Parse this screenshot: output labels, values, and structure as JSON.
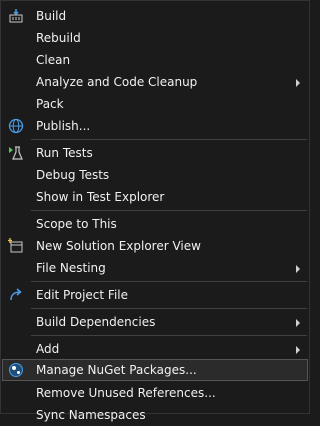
{
  "menu": {
    "build": "Build",
    "rebuild": "Rebuild",
    "clean": "Clean",
    "analyze": "Analyze and Code Cleanup",
    "pack": "Pack",
    "publish": "Publish...",
    "run_tests": "Run Tests",
    "debug_tests": "Debug Tests",
    "show_test_explorer": "Show in Test Explorer",
    "scope_to_this": "Scope to This",
    "new_solution_explorer_view": "New Solution Explorer View",
    "file_nesting": "File Nesting",
    "edit_project_file": "Edit Project File",
    "build_dependencies": "Build Dependencies",
    "add": "Add",
    "manage_nuget": "Manage NuGet Packages...",
    "remove_unused_refs": "Remove Unused References...",
    "sync_namespaces": "Sync Namespaces"
  },
  "icons": {
    "build": "build-icon",
    "publish": "globe-icon",
    "run_tests": "flask-icon",
    "new_view": "window-icon",
    "edit_project": "redo-arrow-icon",
    "nuget": "nuget-icon"
  },
  "colors": {
    "background": "#1b1b1c",
    "text": "#f1f1f1",
    "accent_blue": "#4a9de7",
    "accent_green": "#58c75c"
  }
}
